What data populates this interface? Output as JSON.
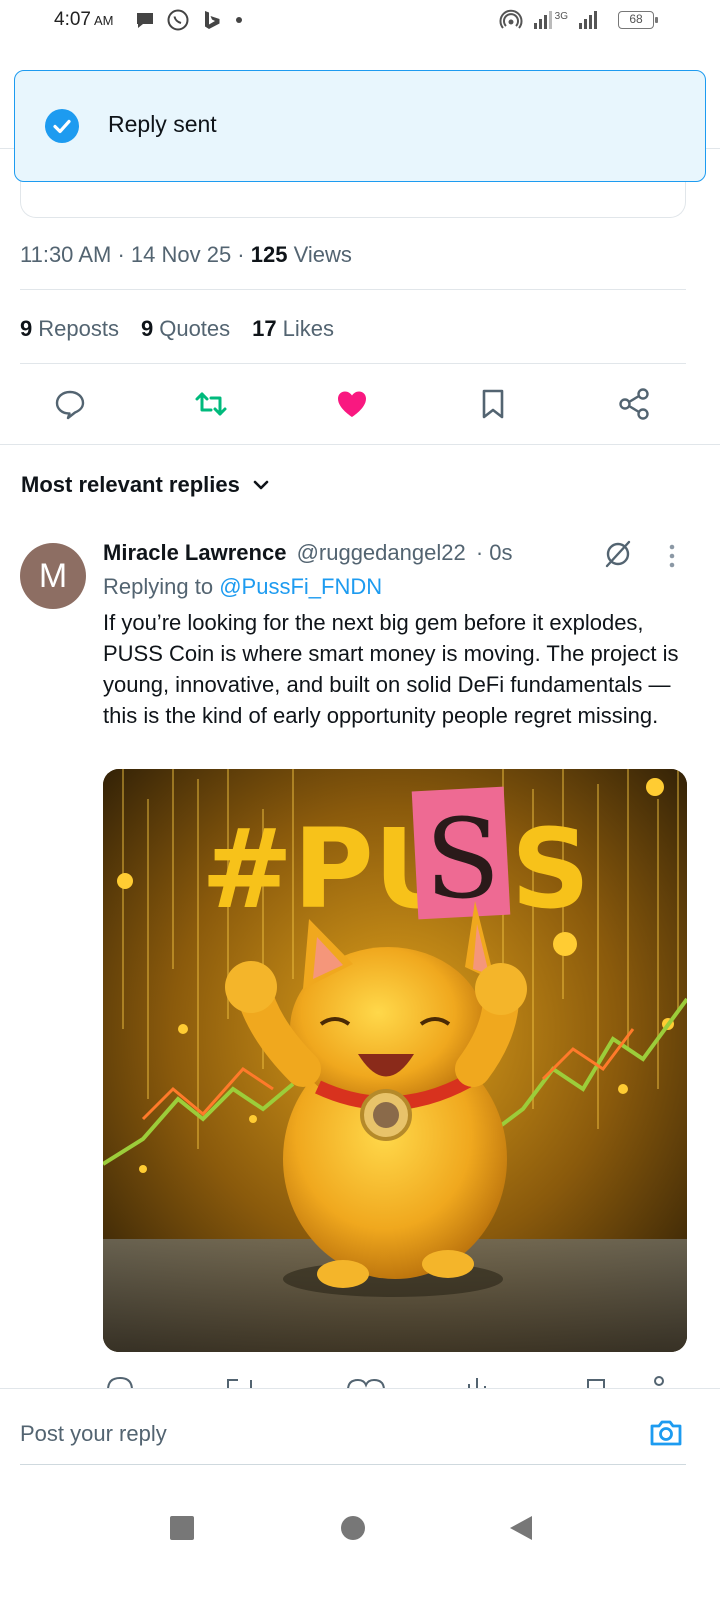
{
  "status_bar": {
    "time": "4:07",
    "ampm": "AM",
    "battery": "68",
    "network": "3G"
  },
  "toast": {
    "text": "Reply sent"
  },
  "tweet": {
    "time": "11:30 AM",
    "date": "14 Nov 25",
    "views_count": "125",
    "views_label": "Views",
    "reposts_count": "9",
    "reposts_label": "Reposts",
    "quotes_count": "9",
    "quotes_label": "Quotes",
    "likes_count": "17",
    "likes_label": "Likes"
  },
  "sort": {
    "label": "Most relevant replies"
  },
  "reply": {
    "avatar_letter": "M",
    "name": "Miracle Lawrence",
    "handle": "@ruggedangel22",
    "age": "· 0s",
    "replying_prefix": "Replying to",
    "replying_mention": "@PussFi_FNDN",
    "body": "If you’re looking for the next big gem before it explodes, PUSS Coin is where smart money is moving. The project is young, innovative, and built on solid DeFi fundamentals — this is the kind of early opportunity people regret missing.",
    "image_text_left": "#PU",
    "image_text_mid": "S",
    "image_text_right": "S"
  },
  "composer": {
    "placeholder": "Post your reply"
  },
  "colors": {
    "accent": "#1d9bf0",
    "like": "#f91880",
    "repost": "#00ba7c"
  }
}
